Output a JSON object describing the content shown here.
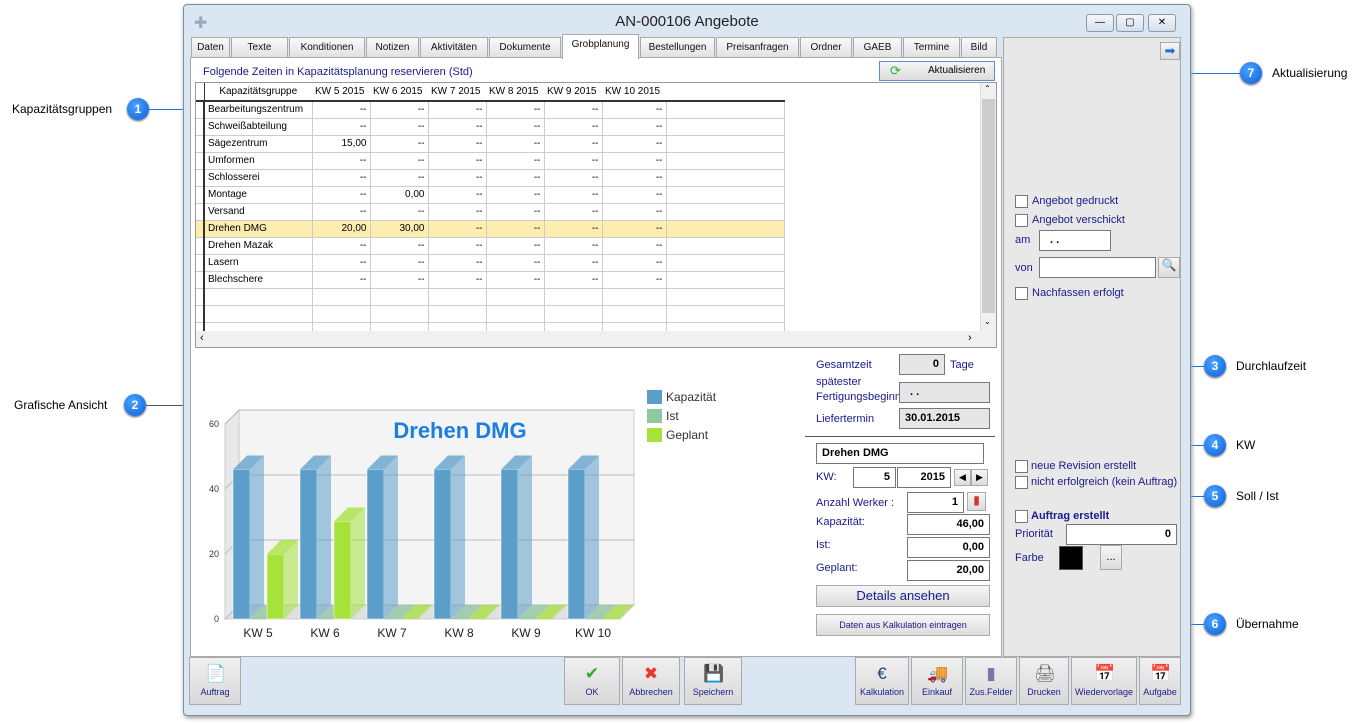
{
  "window": {
    "title": "AN-000106 Angebote",
    "buttons": [
      "minimize",
      "maximize",
      "close"
    ]
  },
  "tabs": [
    {
      "label": "Daten"
    },
    {
      "label": "Texte"
    },
    {
      "label": "Konditionen"
    },
    {
      "label": "Notizen"
    },
    {
      "label": "Aktivitäten"
    },
    {
      "label": "Dokumente"
    },
    {
      "label": "Grobplanung",
      "active": true
    },
    {
      "label": "Bestellungen"
    },
    {
      "label": "Preisanfragen"
    },
    {
      "label": "Ordner"
    },
    {
      "label": "GAEB"
    },
    {
      "label": "Termine"
    },
    {
      "label": "Bild"
    }
  ],
  "grob": {
    "heading": "Folgende Zeiten in Kapazitätsplanung reservieren (Std)",
    "refresh_label": "Aktualisieren",
    "columns": [
      "Kapazitätsgruppe",
      "KW 5 2015",
      "KW 6 2015",
      "KW 7 2015",
      "KW 8 2015",
      "KW 9 2015",
      "KW 10 2015"
    ],
    "rows": [
      [
        "Bearbeitungszentrum",
        "--",
        "--",
        "--",
        "--",
        "--",
        "--"
      ],
      [
        "Schweißabteilung",
        "--",
        "--",
        "--",
        "--",
        "--",
        "--"
      ],
      [
        "Sägezentrum",
        "15,00",
        "--",
        "--",
        "--",
        "--",
        "--"
      ],
      [
        "Umformen",
        "--",
        "--",
        "--",
        "--",
        "--",
        "--"
      ],
      [
        "Schlosserei",
        "--",
        "--",
        "--",
        "--",
        "--",
        "--"
      ],
      [
        "Montage",
        "--",
        "0,00",
        "--",
        "--",
        "--",
        "--"
      ],
      [
        "Versand",
        "--",
        "--",
        "--",
        "--",
        "--",
        "--"
      ],
      [
        "Drehen DMG",
        "20,00",
        "30,00",
        "--",
        "--",
        "--",
        "--"
      ],
      [
        "Drehen Mazak",
        "--",
        "--",
        "--",
        "--",
        "--",
        "--"
      ],
      [
        "Lasern",
        "--",
        "--",
        "--",
        "--",
        "--",
        "--"
      ],
      [
        "Blechschere",
        "--",
        "--",
        "--",
        "--",
        "--",
        "--"
      ]
    ],
    "selected_row": "Drehen DMG"
  },
  "chart_data": {
    "type": "bar",
    "title": "Drehen DMG",
    "categories": [
      "KW 5",
      "KW 6",
      "KW 7",
      "KW 8",
      "KW 9",
      "KW 10"
    ],
    "series": [
      {
        "name": "Kapazität",
        "values": [
          46,
          46,
          46,
          46,
          46,
          46
        ],
        "color": "#5b9ec9"
      },
      {
        "name": "Ist",
        "values": [
          0,
          0,
          0,
          0,
          0,
          0
        ],
        "color": "#8fc7a0"
      },
      {
        "name": "Geplant",
        "values": [
          20,
          30,
          0,
          0,
          0,
          0
        ],
        "color": "#a6e23a"
      }
    ],
    "ylim": [
      0,
      60
    ],
    "yticks": [
      0,
      20,
      40,
      60
    ],
    "legend": "right",
    "style": "3d",
    "grid": true
  },
  "details": {
    "gesamtzeit_label": "Gesamtzeit",
    "gesamtzeit": "0",
    "tage": "Tage",
    "fert_label1": "spätester",
    "fert_label2": "Fertigungsbeginn",
    "fert_value": ". .",
    "liefer_label": "Liefertermin",
    "liefer_value": "30.01.2015",
    "group": "Drehen DMG",
    "kw_label": "KW:",
    "kw": "5",
    "year": "2015",
    "werker_label": "Anzahl Werker :",
    "werker": "1",
    "kap_label": "Kapazität:",
    "kap": "46,00",
    "ist_label": "Ist:",
    "ist": "0,00",
    "geplant_label": "Geplant:",
    "geplant": "20,00",
    "details_btn": "Details ansehen",
    "kalk_btn": "Daten aus Kalkulation eintragen"
  },
  "side": {
    "gedruckt": "Angebot gedruckt",
    "verschickt": "Angebot verschickt",
    "am": "am",
    "am_value": ". .",
    "von": "von",
    "von_value": "",
    "nachfassen": "Nachfassen erfolgt",
    "revision": "neue Revision erstellt",
    "nicht": "nicht erfolgreich (kein Auftrag)",
    "auftrag": "Auftrag erstellt",
    "prio_label": "Priorität",
    "prio": "0",
    "farbe": "Farbe",
    "farbe_color": "#000000",
    "more": "..."
  },
  "toolbar": {
    "auftrag": "Auftrag",
    "ok": "OK",
    "abbrechen": "Abbrechen",
    "speichern": "Speichern",
    "kalkulation": "Kalkulation",
    "einkauf": "Einkauf",
    "zus": "Zus.Felder",
    "drucken": "Drucken",
    "wieder": "Wiedervorlage",
    "aufgabe": "Aufgabe"
  },
  "callouts": [
    {
      "n": "1",
      "label": "Kapazitätsgruppen"
    },
    {
      "n": "2",
      "label": "Grafische Ansicht"
    },
    {
      "n": "3",
      "label": "Durchlaufzeit"
    },
    {
      "n": "4",
      "label": "KW"
    },
    {
      "n": "5",
      "label": "Soll / Ist"
    },
    {
      "n": "6",
      "label": "Übernahme"
    },
    {
      "n": "7",
      "label": "Aktualisierung"
    }
  ]
}
